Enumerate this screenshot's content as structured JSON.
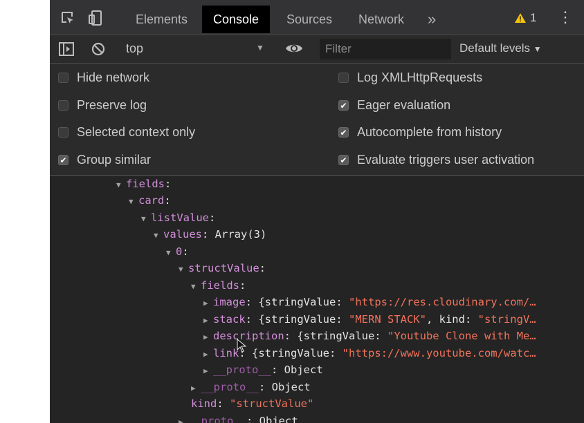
{
  "tabs": {
    "elements": "Elements",
    "console": "Console",
    "sources": "Sources",
    "network": "Network",
    "more": "»"
  },
  "warnings_count": "1",
  "toolbar": {
    "context": "top",
    "filter_placeholder": "Filter",
    "levels": "Default levels"
  },
  "settings": {
    "hide_network": {
      "label": "Hide network",
      "checked": false
    },
    "preserve_log": {
      "label": "Preserve log",
      "checked": false
    },
    "selected_context_only": {
      "label": "Selected context only",
      "checked": false
    },
    "group_similar": {
      "label": "Group similar",
      "checked": true
    },
    "log_xhr": {
      "label": "Log XMLHttpRequests",
      "checked": false
    },
    "eager_evaluation": {
      "label": "Eager evaluation",
      "checked": true
    },
    "autocomplete_history": {
      "label": "Autocomplete from history",
      "checked": true
    },
    "evaluate_triggers": {
      "label": "Evaluate triggers user activation",
      "checked": true
    }
  },
  "console_lines": {
    "fields_key": "fields",
    "card_key": "card",
    "listValue_key": "listValue",
    "values_key": "values",
    "values_val": "Array(3)",
    "index0_key": "0",
    "structValue_key": "structValue",
    "fields2_key": "fields",
    "image_key": "image",
    "image_rest": "{stringValue: ",
    "image_str": "\"https://res.cloudinary.com/…",
    "stack_key": "stack",
    "stack_rest": "{stringValue: ",
    "stack_str": "\"MERN STACK\"",
    "stack_rest2": ", kind: ",
    "stack_str2": "\"stringV…",
    "description_key": "description",
    "description_rest": "{stringValue: ",
    "description_str": "\"Youtube Clone with Me…",
    "link_key": "link",
    "link_rest": "{stringValue: ",
    "link_str": "\"https://www.youtube.com/watc…",
    "proto_key": "__proto__",
    "proto_val": "Object",
    "kind_key": "kind",
    "kind_str": "\"structValue\""
  }
}
